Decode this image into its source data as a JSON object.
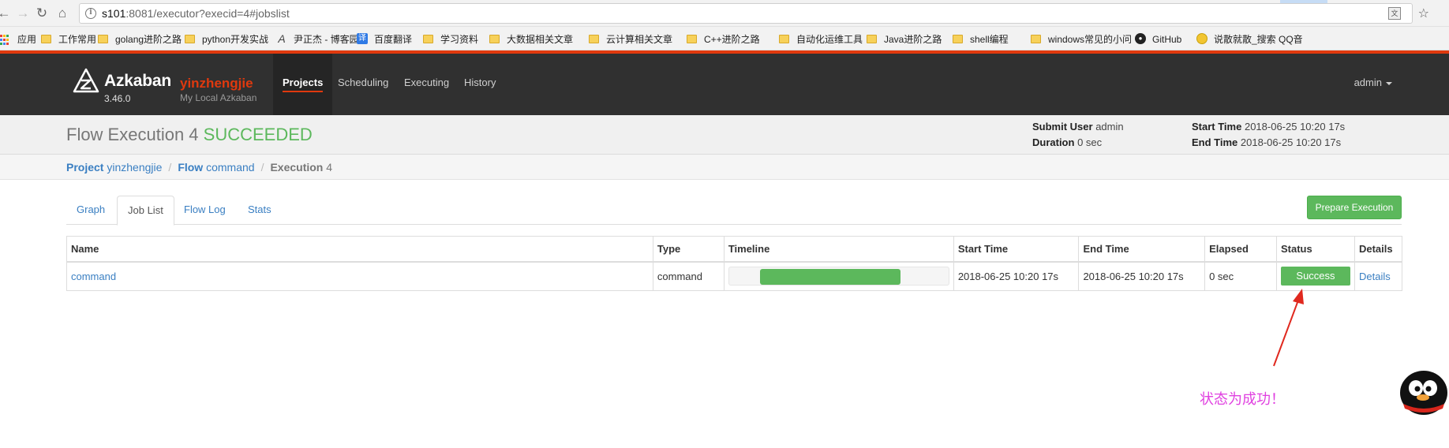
{
  "browser": {
    "url_host": "s101",
    "url_rest": ":8081/executor?execid=4#jobslist",
    "bookmarks": [
      {
        "label": "应用",
        "icon": "apps-grid-icon"
      },
      {
        "label": "工作常用",
        "icon": "folder-icon"
      },
      {
        "label": "golang进阶之路",
        "icon": "folder-icon"
      },
      {
        "label": "python开发实战",
        "icon": "folder-icon"
      },
      {
        "label": "尹正杰 - 博客园",
        "icon": "site-icon"
      },
      {
        "label": "百度翻译",
        "icon": "translate-icon"
      },
      {
        "label": "学习资料",
        "icon": "folder-icon"
      },
      {
        "label": "大数据相关文章",
        "icon": "folder-icon"
      },
      {
        "label": "云计算相关文章",
        "icon": "folder-icon"
      },
      {
        "label": "C++进阶之路",
        "icon": "folder-icon"
      },
      {
        "label": "自动化运维工具",
        "icon": "folder-icon"
      },
      {
        "label": "Java进阶之路",
        "icon": "folder-icon"
      },
      {
        "label": "shell编程",
        "icon": "folder-icon"
      },
      {
        "label": "windows常见的小问",
        "icon": "folder-icon"
      },
      {
        "label": "GitHub",
        "icon": "github-icon"
      },
      {
        "label": "说散就散_搜索 QQ音",
        "icon": "qq-music-icon"
      }
    ]
  },
  "navbar": {
    "brand": "Azkaban",
    "brand_name": "yinzhengjie",
    "version": "3.46.0",
    "env": "My Local Azkaban",
    "items": [
      "Projects",
      "Scheduling",
      "Executing",
      "History"
    ],
    "active": "Projects",
    "user": "admin"
  },
  "header": {
    "title_prefix": "Flow Execution 4",
    "status": "SUCCEEDED",
    "submit_user_label": "Submit User",
    "submit_user": "admin",
    "duration_label": "Duration",
    "duration": "0 sec",
    "start_time_label": "Start Time",
    "start_time": "2018-06-25 10:20 17s",
    "end_time_label": "End Time",
    "end_time": "2018-06-25 10:20 17s"
  },
  "breadcrumb": {
    "project_label": "Project",
    "project": "yinzhengjie",
    "flow_label": "Flow",
    "flow": "command",
    "execution_label": "Execution",
    "execution": "4"
  },
  "tabs": [
    "Graph",
    "Job List",
    "Flow Log",
    "Stats"
  ],
  "active_tab": "Job List",
  "prepare_button": "Prepare Execution",
  "table": {
    "columns": [
      "Name",
      "Type",
      "Timeline",
      "Start Time",
      "End Time",
      "Elapsed",
      "Status",
      "Details"
    ],
    "rows": [
      {
        "name": "command",
        "type": "command",
        "timeline_start_fraction": 0.14,
        "timeline_end_fraction": 0.78,
        "start_time": "2018-06-25 10:20 17s",
        "end_time": "2018-06-25 10:20 17s",
        "elapsed": "0 sec",
        "status": "Success",
        "details": "Details"
      }
    ]
  },
  "annotation": {
    "text": "状态为成功！",
    "color": "#e040e0"
  },
  "colors": {
    "accent": "#e0390e",
    "success": "#5cb85c",
    "link": "#3a7fc2",
    "navbar_bg": "#303030"
  }
}
